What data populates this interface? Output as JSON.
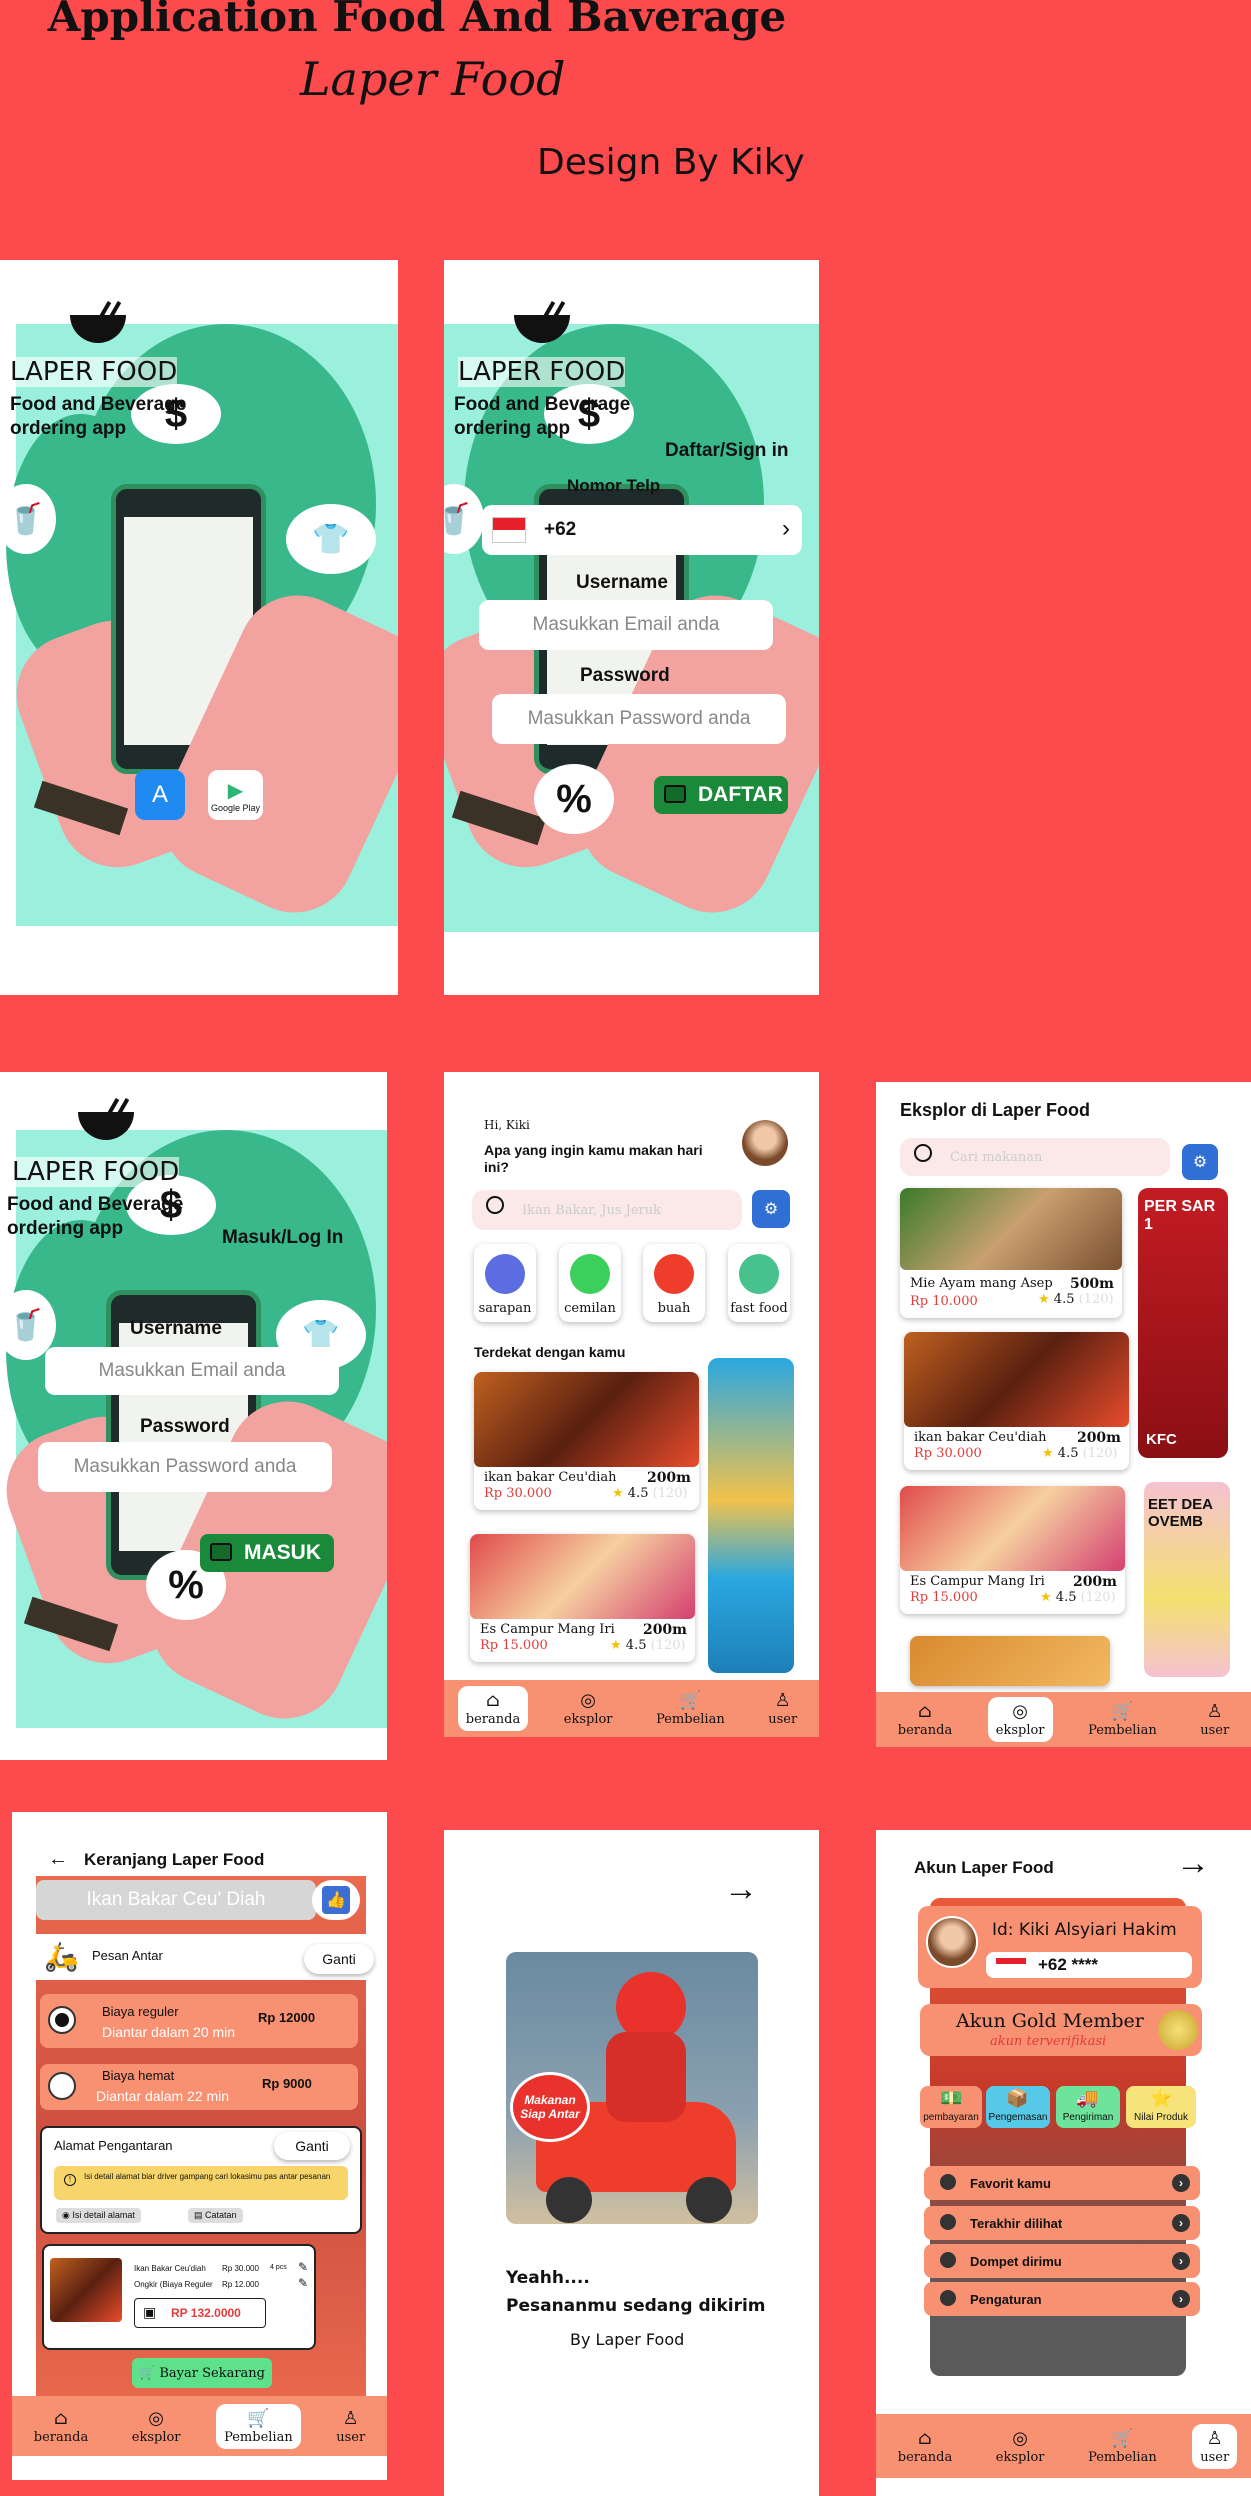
{
  "header": {
    "title": "Application Food And Baverage",
    "app_name": "Laper Food",
    "credit": "Design By Kiky"
  },
  "splash": {
    "brand": "LAPER FOOD",
    "tagline_1": "Food and Beverage",
    "tagline_2": "ordering app",
    "dollar": "$",
    "percent": "%",
    "google_play": "Google Play"
  },
  "signup": {
    "heading": "Daftar/Sign in",
    "phone_label": "Nomor Telp",
    "phone_code": "+62",
    "username_label": "Username",
    "email_placeholder": "Masukkan Email anda",
    "password_label": "Password",
    "password_placeholder": "Masukkan Password anda",
    "submit": "DAFTAR"
  },
  "login": {
    "heading": "Masuk/Log In",
    "username_label": "Username",
    "email_placeholder": "Masukkan Email anda",
    "password_label": "Password",
    "password_placeholder": "Masukkan Password anda",
    "submit": "MASUK"
  },
  "home": {
    "greeting": "Hi, Kiki",
    "question": "Apa yang ingin kamu makan hari ini?",
    "search_placeholder": "Ikan Bakar, Jus Jeruk",
    "categories": [
      "sarapan",
      "cemilan",
      "buah",
      "fast food"
    ],
    "nearby_heading": "Terdekat dengan kamu",
    "items": [
      {
        "name": "ikan bakar Ceu'diah",
        "distance": "200m",
        "price": "Rp 30.000",
        "rating": "4.5",
        "count": "(120)"
      },
      {
        "name": "Es Campur Mang Iri",
        "distance": "200m",
        "price": "Rp 15.000",
        "rating": "4.5",
        "count": "(120)"
      }
    ]
  },
  "nav": {
    "beranda": "beranda",
    "eksplor": "eksplor",
    "pembelian": "Pembelian",
    "user": "user"
  },
  "explore": {
    "heading": "Eksplor di Laper Food",
    "search_placeholder": "Cari makanan",
    "items": [
      {
        "name": "Mie Ayam mang Asep",
        "distance": "500m",
        "price": "Rp 10.000",
        "rating": "4.5",
        "count": "(120)"
      },
      {
        "name": "ikan bakar Ceu'diah",
        "distance": "200m",
        "price": "Rp 30.000",
        "rating": "4.5",
        "count": "(120)"
      },
      {
        "name": "Es Campur Mang Iri",
        "distance": "200m",
        "price": "Rp 15.000",
        "rating": "4.5",
        "count": "(120)"
      }
    ],
    "ad_1": "PER SAR 1",
    "ad_1b": "KFC",
    "ad_2": "EET DEA OVEMB"
  },
  "cart": {
    "heading": "Keranjang Laper Food",
    "item_banner": "Ikan Bakar Ceu' Diah",
    "delivery_mode": "Pesan Antar",
    "change": "Ganti",
    "options": [
      {
        "name": "Biaya reguler",
        "eta": "Diantar dalam 20 min",
        "price": "Rp 12000",
        "selected": true
      },
      {
        "name": "Biaya hemat",
        "eta": "Diantar dalam 22 min",
        "price": "Rp 9000",
        "selected": false
      }
    ],
    "address_heading": "Alamat Pengantaran",
    "address_note": "Isi detail alamat biar driver gampang cari lokasimu pas antar pesanan",
    "address_detail": "Isi detail alamat",
    "address_notes": "Catatan",
    "line_item": "Ikan Bakar Ceu'diah",
    "line_price": "Rp 30.000",
    "line_qty": "4 pcs",
    "shipping": "Ongkir (Biaya Reguler",
    "shipping_price": "Rp 12.000",
    "total": "RP 132.0000",
    "pay": "Bayar Sekarang"
  },
  "sending": {
    "line_1": "Yeahh....",
    "line_2": "Pesananmu sedang dikirim",
    "byline": "By Laper Food",
    "sign_1": "Makanan",
    "sign_2": "Siap Antar"
  },
  "account": {
    "heading": "Akun  Laper Food",
    "user_id": "Id: Kiki Alsyiari Hakim",
    "phone": "+62 ****",
    "member": "Akun Gold Member",
    "verified": "akun terverifikasi",
    "actions": [
      "pembayaran",
      "Pengemasan",
      "Pengiriman",
      "Nilai Produk"
    ],
    "menu": [
      "Favorit kamu",
      "Terakhir dilihat",
      "Dompet dirimu",
      "Pengaturan"
    ]
  },
  "colors": {
    "background": "#fc4a4d",
    "accent": "#f89072",
    "hero": "#9af0dc",
    "confirm": "#1a8a3a"
  }
}
